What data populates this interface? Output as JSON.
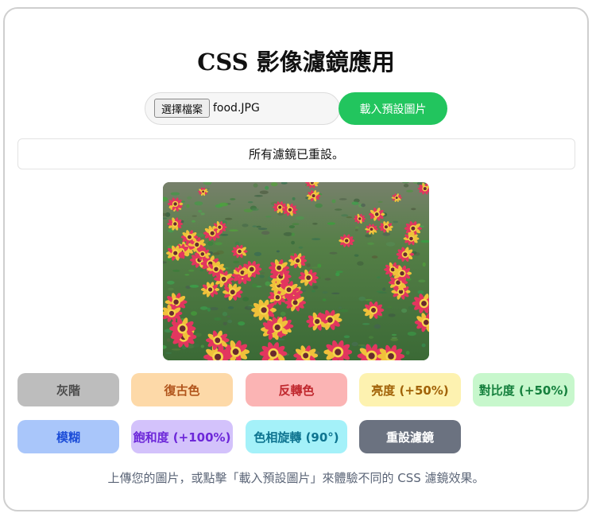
{
  "title": "CSS 影像濾鏡應用",
  "file_input": {
    "button_label": "選擇檔案",
    "file_name": "food.JPG"
  },
  "load_button": "載入預設圖片",
  "status_message": "所有濾鏡已重設。",
  "filters": {
    "grayscale": "灰階",
    "sepia": "復古色",
    "invert": "反轉色",
    "brightness": "亮度 (+50%)",
    "contrast": "對比度 (+50%)",
    "blur": "模糊",
    "saturate": "飽和度 (+100%)",
    "hue_rotate": "色相旋轉 (90°)",
    "reset": "重設濾鏡"
  },
  "colors": {
    "grayscale_bg": "#bdbdbd",
    "grayscale_fg": "#4b4b4b",
    "sepia_bg": "#fdd9a8",
    "sepia_fg": "#b1551c",
    "invert_bg": "#fbb4b4",
    "invert_fg": "#c0282e",
    "brightness_bg": "#fdf2b0",
    "brightness_fg": "#a16207",
    "contrast_bg": "#c7f7cc",
    "contrast_fg": "#15803d",
    "blur_bg": "#a9c6fa",
    "blur_fg": "#1d4ed8",
    "saturate_bg": "#d3c2fb",
    "saturate_fg": "#6d28d9",
    "hue_bg": "#a4f1f9",
    "hue_fg": "#0e7490",
    "reset_bg": "#6b7280",
    "reset_fg": "#ffffff",
    "load_bg": "#22c55e"
  },
  "hint": "上傳您的圖片，或點擊「載入預設圖片」來體驗不同的 CSS 濾鏡效果。",
  "image": {
    "subject": "pink-yellow gaillardia flowers field"
  }
}
